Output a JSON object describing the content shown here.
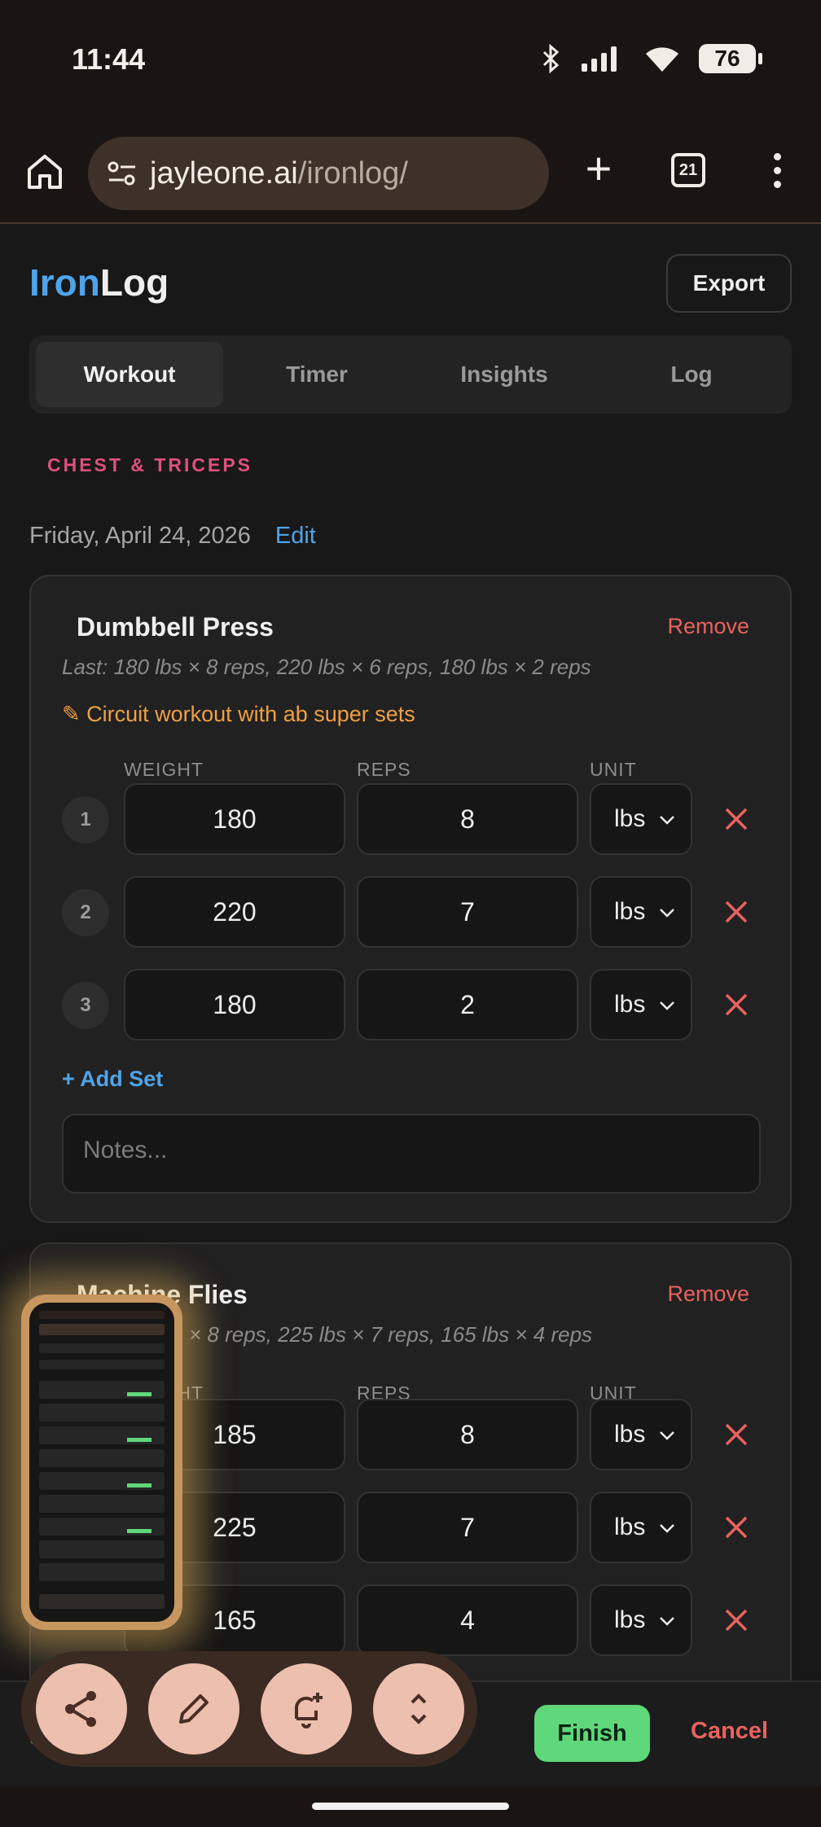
{
  "status": {
    "time": "11:44",
    "battery": "76"
  },
  "browser": {
    "url_host": "jayleone.ai",
    "url_path": "/ironlog/",
    "tab_count": "21"
  },
  "app": {
    "logo_part1": "Iron",
    "logo_part2": "Log",
    "export_label": "Export",
    "tabs": [
      "Workout",
      "Timer",
      "Insights",
      "Log"
    ],
    "active_tab": "Workout",
    "workout_title": "CHEST & TRICEPS",
    "date": "Friday, April 24, 2026",
    "edit_label": "Edit"
  },
  "columns": {
    "weight": "WEIGHT",
    "reps": "REPS",
    "unit": "UNIT"
  },
  "exercises": [
    {
      "name": "Dumbbell Press",
      "remove_label": "Remove",
      "last": "Last: 180 lbs × 8 reps, 220 lbs × 6 reps, 180 lbs × 2 reps",
      "note": "✎ Circuit workout with ab super sets",
      "sets": [
        {
          "num": "1",
          "weight": "180",
          "reps": "8",
          "unit": "lbs"
        },
        {
          "num": "2",
          "weight": "220",
          "reps": "7",
          "unit": "lbs"
        },
        {
          "num": "3",
          "weight": "180",
          "reps": "2",
          "unit": "lbs"
        }
      ],
      "add_set_label": "+ Add Set",
      "notes_placeholder": "Notes..."
    },
    {
      "name": "Machine Flies",
      "remove_label": "Remove",
      "last": "× 8 reps, 225 lbs × 7 reps, 165 lbs × 4 reps",
      "sets": [
        {
          "weight": "185",
          "reps": "8",
          "unit": "lbs"
        },
        {
          "weight": "225",
          "reps": "7",
          "unit": "lbs"
        },
        {
          "weight": "165",
          "reps": "4",
          "unit": "lbs"
        }
      ]
    }
  ],
  "bottom": {
    "finish_label": "Finish",
    "cancel_label": "Cancel",
    "stub": "S"
  },
  "colors": {
    "accent": "#4ea4ea",
    "danger": "#e8625e",
    "section": "#e0507c",
    "success": "#5ed87a",
    "note": "#efa042"
  },
  "icons": [
    "home-icon",
    "site-settings-icon",
    "plus-icon",
    "tab-switcher-icon",
    "more-vert-icon",
    "share-icon",
    "pencil-icon",
    "add-alert-icon",
    "expand-collapse-icon",
    "close-icon",
    "chevron-down-icon",
    "bluetooth-icon",
    "signal-icon",
    "wifi-icon"
  ]
}
